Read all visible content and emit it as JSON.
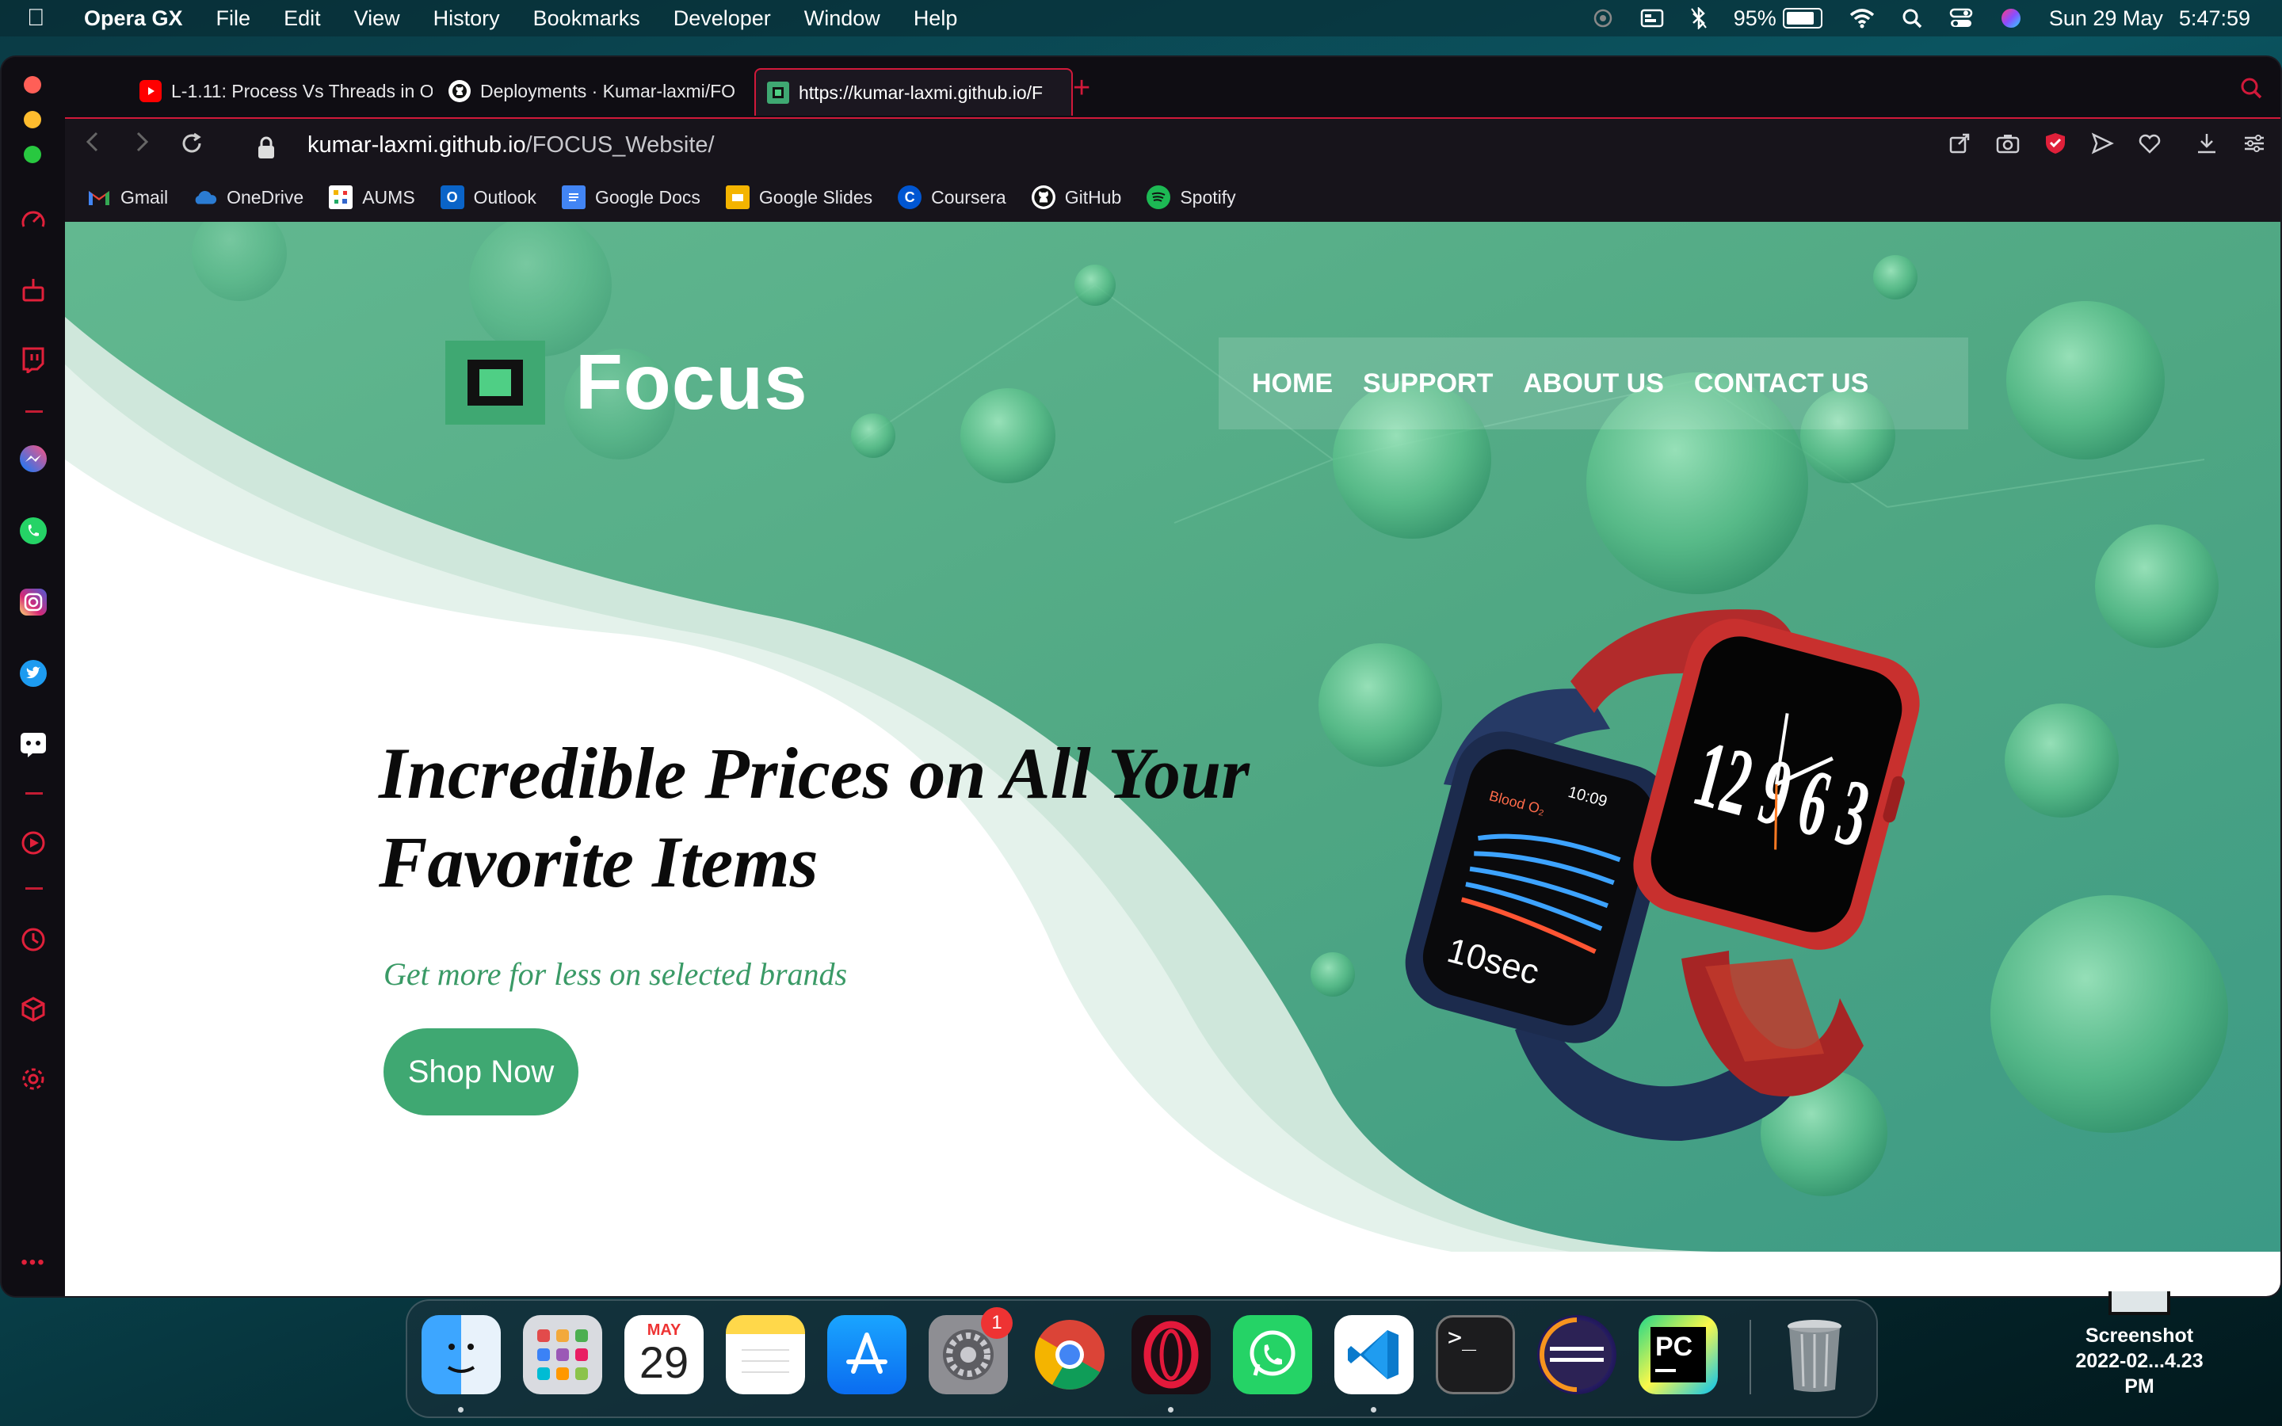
{
  "menubar": {
    "app_name": "Opera GX",
    "items": [
      "File",
      "Edit",
      "View",
      "History",
      "Bookmarks",
      "Developer",
      "Window",
      "Help"
    ],
    "battery": "95%",
    "battery_level": 0.95,
    "date": "Sun 29 May",
    "time": "5:47:59"
  },
  "tabs": [
    {
      "label": "L-1.11: Process Vs Threads in O",
      "icon": "youtube-icon",
      "active": false
    },
    {
      "label": "Deployments · Kumar-laxmi/FO",
      "icon": "github-icon",
      "active": false
    },
    {
      "label": "https://kumar-laxmi.github.io/F",
      "icon": "site-favicon",
      "active": true
    }
  ],
  "address": {
    "domain": "kumar-laxmi.github.io",
    "path": "/FOCUS_Website/"
  },
  "bookmarks": [
    {
      "label": "Gmail",
      "icon": "gmail-icon",
      "color": "#ea4335"
    },
    {
      "label": "OneDrive",
      "icon": "onedrive-icon",
      "color": "#2b7cd3"
    },
    {
      "label": "AUMS",
      "icon": "aums-icon",
      "color": "#f4b400"
    },
    {
      "label": "Outlook",
      "icon": "outlook-icon",
      "color": "#0a64c8"
    },
    {
      "label": "Google Docs",
      "icon": "google-docs-icon",
      "color": "#4285f4"
    },
    {
      "label": "Google Slides",
      "icon": "google-slides-icon",
      "color": "#f4b400"
    },
    {
      "label": "Coursera",
      "icon": "coursera-icon",
      "color": "#0056d2"
    },
    {
      "label": "GitHub",
      "icon": "github-icon",
      "color": "#ffffff"
    },
    {
      "label": "Spotify",
      "icon": "spotify-icon",
      "color": "#1db954"
    }
  ],
  "site": {
    "brand": "Focus",
    "nav": [
      "HOME",
      "SUPPORT",
      "ABOUT US",
      "CONTACT US"
    ],
    "headline_line1": "Incredible Prices on All Your",
    "headline_line2": "Favorite Items",
    "subline": "Get more for less on selected brands",
    "cta": "Shop Now",
    "accent": "#3fa872",
    "watch_face_time": "10:09",
    "watch_label": "Blood O₂",
    "watch_timer": "10sec",
    "watch_dial": "12 9 6 3"
  },
  "dock": {
    "calendar_month": "MAY",
    "calendar_day": "29",
    "settings_badge": "1"
  },
  "desktop_file": {
    "name": "Screenshot",
    "date": "2022-02...4.23 PM"
  }
}
